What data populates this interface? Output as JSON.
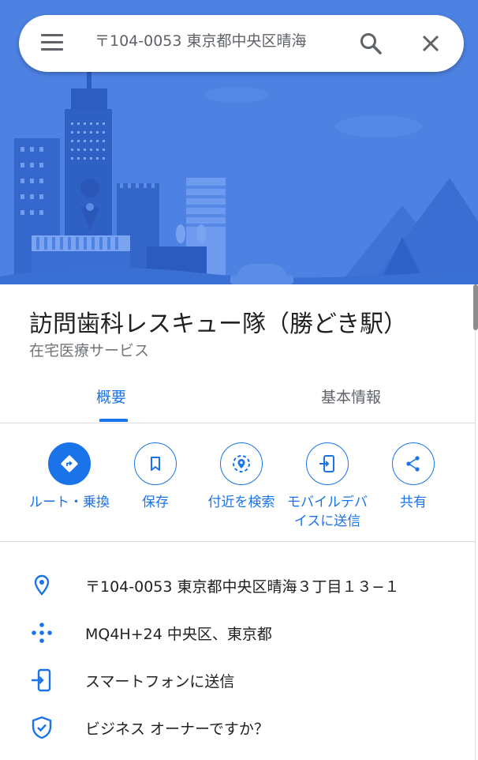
{
  "search": {
    "query": "〒104-0053 東京都中央区晴海",
    "menu_icon": "hamburger-menu-icon",
    "search_icon": "magnifier-icon",
    "close_icon": "close-x-icon"
  },
  "place": {
    "title": "訪問歯科レスキュー隊（勝どき駅）",
    "category": "在宅医療サービス"
  },
  "tabs": [
    {
      "label": "概要",
      "active": true
    },
    {
      "label": "基本情報",
      "active": false
    }
  ],
  "actions": [
    {
      "label": "ルート・乗換",
      "icon": "directions-icon"
    },
    {
      "label": "保存",
      "icon": "bookmark-icon"
    },
    {
      "label": "付近を検索",
      "icon": "nearby-search-icon"
    },
    {
      "label_line1": "モバイルデバ",
      "label_line2": "イスに送信",
      "icon": "send-to-phone-icon"
    },
    {
      "label": "共有",
      "icon": "share-icon"
    }
  ],
  "info": {
    "address": "〒104-0053 東京都中央区晴海３丁目１３−１",
    "plus_code": "MQ4H+24 中央区、東京都",
    "send_to_phone": "スマートフォンに送信",
    "claim_business": "ビジネス オーナーですか？"
  },
  "colors": {
    "accent": "#1a73e8",
    "hero_bg": "#4a7fe0",
    "text_secondary": "#70757a"
  }
}
